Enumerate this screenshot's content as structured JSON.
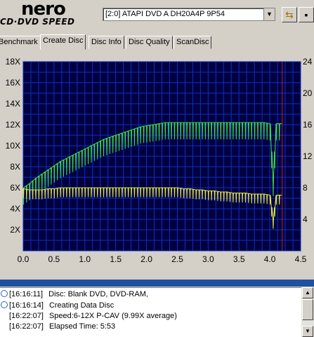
{
  "app": {
    "logo_line1": "nero",
    "logo_line2": "CD·DVD SPEED"
  },
  "drive_select": {
    "value": "[2:0]   ATAPI DVD A  DH20A4P 9P54"
  },
  "toolbar": {
    "btn1_icon": "swap-icon",
    "btn2_icon": "save-icon"
  },
  "tabs": [
    "Benchmark",
    "Create Disc",
    "Disc Info",
    "Disc Quality",
    "ScanDisc"
  ],
  "active_tab": "Create Disc",
  "chart_data": {
    "type": "line",
    "x_ticks": [
      "0.0",
      "0.5",
      "1.0",
      "1.5",
      "2.0",
      "2.5",
      "3.0",
      "3.5",
      "4.0",
      "4.5"
    ],
    "y_left_ticks": [
      "2X",
      "4X",
      "6X",
      "8X",
      "10X",
      "12X",
      "14X",
      "16X",
      "18X"
    ],
    "y_right_ticks": [
      "4",
      "8",
      "12",
      "16",
      "20",
      "24"
    ],
    "xlim": [
      0,
      4.5
    ],
    "ylim_left": [
      0,
      18
    ],
    "ylim_right": [
      0,
      24
    ],
    "background": "#000040",
    "grid_color": "#1030c0",
    "series": [
      {
        "color": "#40e040",
        "x": [
          0.0,
          0.1,
          0.2,
          0.3,
          0.4,
          0.5,
          0.6,
          0.7,
          0.8,
          0.9,
          1.0,
          1.1,
          1.2,
          1.3,
          1.4,
          1.5,
          1.6,
          1.7,
          1.8,
          1.9,
          2.0,
          2.1,
          2.2,
          2.3,
          2.4,
          2.5,
          2.6,
          2.7,
          2.8,
          2.9,
          3.0,
          3.1,
          3.2,
          3.3,
          3.4,
          3.5,
          3.6,
          3.7,
          3.8,
          3.9,
          4.0,
          4.05,
          4.1,
          4.2
        ],
        "y": [
          6.0,
          6.4,
          6.9,
          7.3,
          7.7,
          8.1,
          8.5,
          8.8,
          9.1,
          9.4,
          9.7,
          10.0,
          10.3,
          10.6,
          10.8,
          11.0,
          11.2,
          11.4,
          11.6,
          11.8,
          11.9,
          12.0,
          12.1,
          12.2,
          12.2,
          12.2,
          12.2,
          12.2,
          12.2,
          12.2,
          12.2,
          12.2,
          12.2,
          12.2,
          12.2,
          12.2,
          12.2,
          12.2,
          12.2,
          12.2,
          12.1,
          6.8,
          12.1,
          12.1
        ]
      },
      {
        "color": "#e8e840",
        "x": [
          0.0,
          0.1,
          0.2,
          0.3,
          0.4,
          0.5,
          0.6,
          0.7,
          0.8,
          0.9,
          1.0,
          1.1,
          1.2,
          1.3,
          1.4,
          1.5,
          1.6,
          1.7,
          1.8,
          1.9,
          2.0,
          2.1,
          2.2,
          2.3,
          2.4,
          2.5,
          2.6,
          2.7,
          2.8,
          2.9,
          3.0,
          3.1,
          3.2,
          3.3,
          3.4,
          3.5,
          3.6,
          3.7,
          3.8,
          3.9,
          4.0,
          4.05,
          4.1,
          4.2
        ],
        "y": [
          5.9,
          5.8,
          5.8,
          5.8,
          5.9,
          5.9,
          6.0,
          6.0,
          6.0,
          6.0,
          6.0,
          6.0,
          6.0,
          6.0,
          6.0,
          6.0,
          6.0,
          6.0,
          6.0,
          6.0,
          6.0,
          6.0,
          6.0,
          6.0,
          6.0,
          6.0,
          5.9,
          5.9,
          5.8,
          5.8,
          5.7,
          5.7,
          5.6,
          5.6,
          5.5,
          5.5,
          5.5,
          5.4,
          5.4,
          5.4,
          5.3,
          3.0,
          5.3,
          5.3
        ]
      }
    ],
    "marker": {
      "x": 4.2,
      "color": "#c02020"
    }
  },
  "log": [
    {
      "time": "[16:16:11]",
      "text": "Disc: Blank DVD, DVD-RAM,",
      "icon": "info-icon"
    },
    {
      "time": "[16:16:14]",
      "text": "Creating Data Disc",
      "icon": "info-icon"
    },
    {
      "time": "[16:22:07]",
      "text": "Speed:6-12X P-CAV (9.99X average)",
      "icon": ""
    },
    {
      "time": "[16:22:07]",
      "text": "Elapsed Time:  5:53",
      "icon": ""
    }
  ]
}
